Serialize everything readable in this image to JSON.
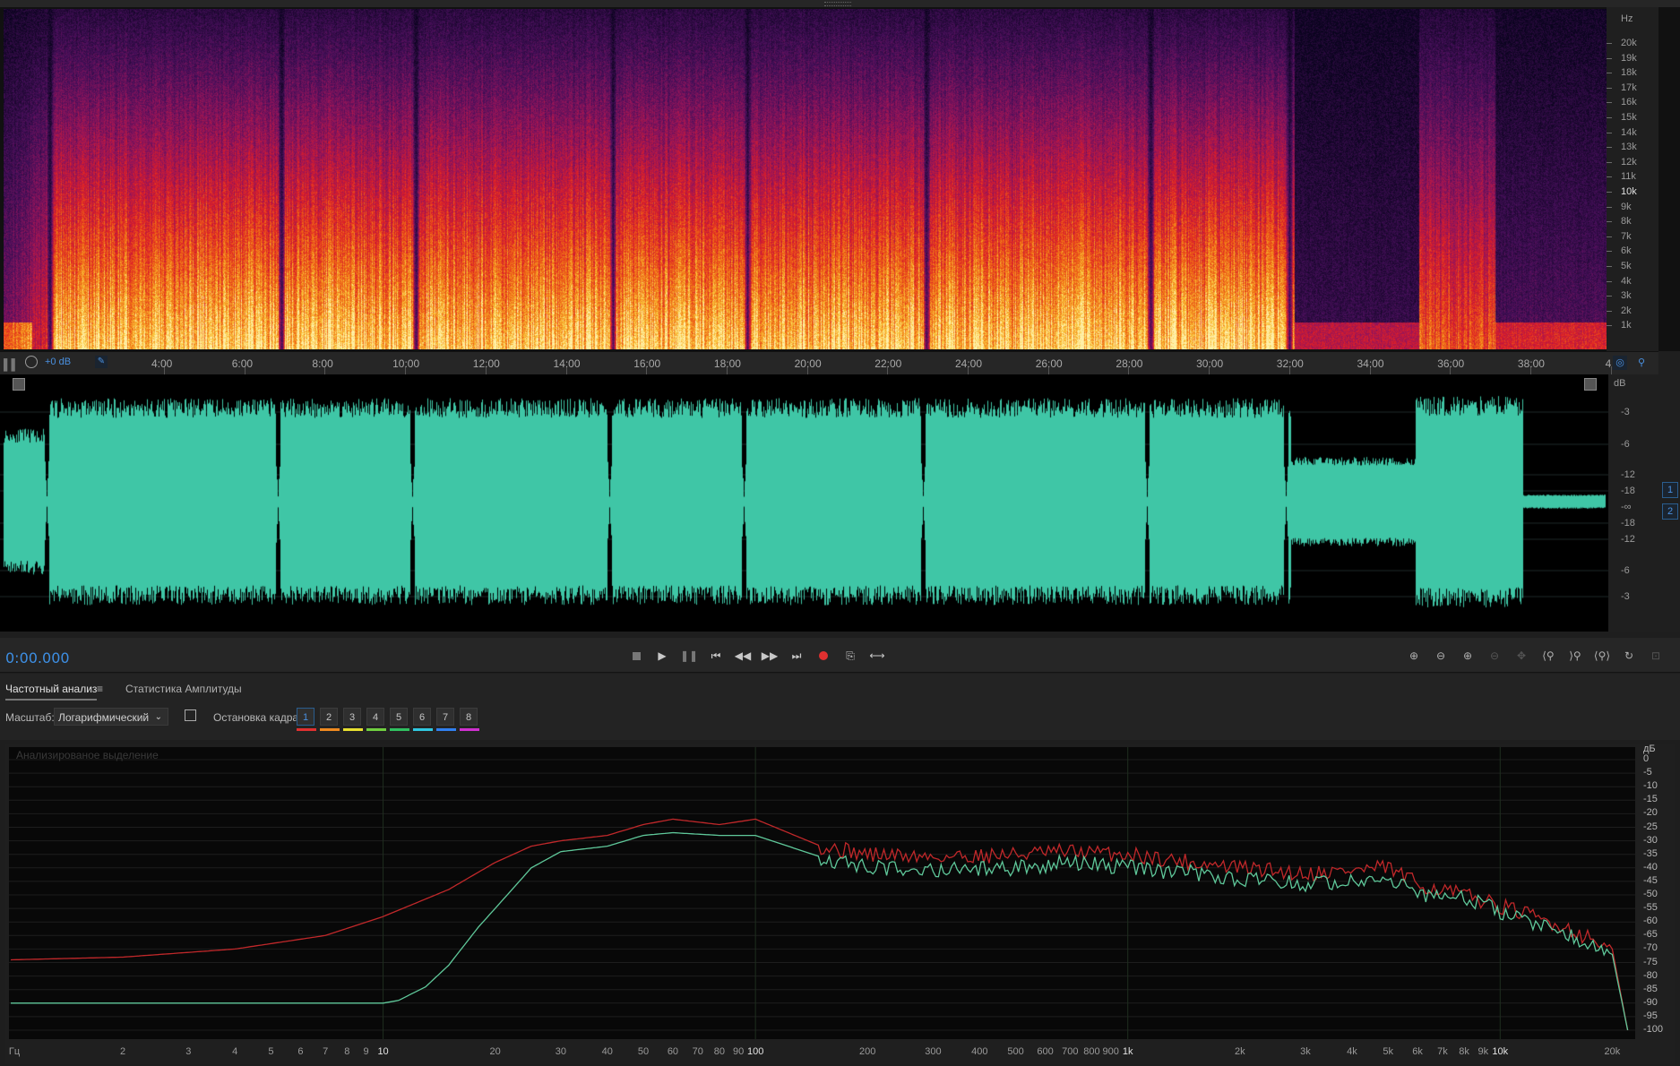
{
  "spectrogram": {
    "ruler_unit": "Hz",
    "freq_labels": [
      {
        "label": "20k",
        "hz": 20000
      },
      {
        "label": "19k",
        "hz": 19000
      },
      {
        "label": "18k",
        "hz": 18000
      },
      {
        "label": "17k",
        "hz": 17000
      },
      {
        "label": "16k",
        "hz": 16000
      },
      {
        "label": "15k",
        "hz": 15000
      },
      {
        "label": "14k",
        "hz": 14000
      },
      {
        "label": "13k",
        "hz": 13000
      },
      {
        "label": "12k",
        "hz": 12000
      },
      {
        "label": "11k",
        "hz": 11000
      },
      {
        "label": "10k",
        "hz": 10000
      },
      {
        "label": "9k",
        "hz": 9000
      },
      {
        "label": "8k",
        "hz": 8000
      },
      {
        "label": "7k",
        "hz": 7000
      },
      {
        "label": "6k",
        "hz": 6000
      },
      {
        "label": "5k",
        "hz": 5000
      },
      {
        "label": "4k",
        "hz": 4000
      },
      {
        "label": "3k",
        "hz": 3000
      },
      {
        "label": "2k",
        "hz": 2000
      },
      {
        "label": "1k",
        "hz": 1000
      }
    ]
  },
  "timeline": {
    "gain": "+0 dB",
    "labels": [
      "4:00",
      "6:00",
      "8:00",
      "10:00",
      "12:00",
      "14:00",
      "16:00",
      "18:00",
      "20:00",
      "22:00",
      "24:00",
      "26:00",
      "28:00",
      "30:00",
      "32:00",
      "34:00",
      "36:00",
      "38:00",
      "4"
    ]
  },
  "waveform": {
    "db_labels": [
      "dB",
      "-3",
      "-6",
      "-12",
      "-18",
      "-∞",
      "-18",
      "-12",
      "-6",
      "-3"
    ],
    "channels": [
      "1",
      "2"
    ],
    "wave_color": "#3fc6a6"
  },
  "transport": {
    "timecode": "0:00.000",
    "record_color": "#e03030"
  },
  "panel": {
    "tab_frequency": "Частотный анализ",
    "tab_amplitude": "Статистика Амплитуды",
    "scale_label": "Масштаб:",
    "scale_value": "Логарифмический",
    "freeze_label": "Остановка кадра:",
    "freeze_buttons": [
      "1",
      "2",
      "3",
      "4",
      "5",
      "6",
      "7",
      "8"
    ],
    "freeze_colors": [
      "#e03030",
      "#f08a20",
      "#e8e030",
      "#70d040",
      "#30c060",
      "#30c8e0",
      "#3080f0",
      "#d030d0"
    ],
    "watermark": "Анализированое выделение"
  },
  "freq_graph": {
    "db_labels": [
      "дБ",
      "0",
      "-5",
      "-10",
      "-15",
      "-20",
      "-25",
      "-30",
      "-35",
      "-40",
      "-45",
      "-50",
      "-55",
      "-60",
      "-65",
      "-70",
      "-75",
      "-80",
      "-85",
      "-90",
      "-95",
      "-100"
    ],
    "x_labels": [
      {
        "label": "Гц",
        "hz": 1
      },
      {
        "label": "2",
        "hz": 2
      },
      {
        "label": "3",
        "hz": 3
      },
      {
        "label": "4",
        "hz": 4
      },
      {
        "label": "5",
        "hz": 5
      },
      {
        "label": "6",
        "hz": 6
      },
      {
        "label": "7",
        "hz": 7
      },
      {
        "label": "8",
        "hz": 8
      },
      {
        "label": "9",
        "hz": 9
      },
      {
        "label": "10",
        "hz": 10
      },
      {
        "label": "20",
        "hz": 20
      },
      {
        "label": "30",
        "hz": 30
      },
      {
        "label": "40",
        "hz": 40
      },
      {
        "label": "50",
        "hz": 50
      },
      {
        "label": "60",
        "hz": 60
      },
      {
        "label": "70",
        "hz": 70
      },
      {
        "label": "80",
        "hz": 80
      },
      {
        "label": "90",
        "hz": 90
      },
      {
        "label": "100",
        "hz": 100
      },
      {
        "label": "200",
        "hz": 200
      },
      {
        "label": "300",
        "hz": 300
      },
      {
        "label": "400",
        "hz": 400
      },
      {
        "label": "500",
        "hz": 500
      },
      {
        "label": "600",
        "hz": 600
      },
      {
        "label": "700",
        "hz": 700
      },
      {
        "label": "800",
        "hz": 800
      },
      {
        "label": "900",
        "hz": 900
      },
      {
        "label": "1k",
        "hz": 1000
      },
      {
        "label": "2k",
        "hz": 2000
      },
      {
        "label": "3k",
        "hz": 3000
      },
      {
        "label": "4k",
        "hz": 4000
      },
      {
        "label": "5k",
        "hz": 5000
      },
      {
        "label": "6k",
        "hz": 6000
      },
      {
        "label": "7k",
        "hz": 7000
      },
      {
        "label": "8k",
        "hz": 8000
      },
      {
        "label": "9k",
        "hz": 9000
      },
      {
        "label": "10k",
        "hz": 10000
      },
      {
        "label": "20k",
        "hz": 20000
      }
    ],
    "series": [
      {
        "color": "#c0282a",
        "points": [
          [
            1,
            -74
          ],
          [
            2,
            -73
          ],
          [
            4,
            -70
          ],
          [
            7,
            -65
          ],
          [
            10,
            -58
          ],
          [
            15,
            -48
          ],
          [
            20,
            -38
          ],
          [
            25,
            -32
          ],
          [
            30,
            -30
          ],
          [
            40,
            -28
          ],
          [
            50,
            -24
          ],
          [
            60,
            -22
          ],
          [
            80,
            -24
          ],
          [
            100,
            -22
          ],
          [
            150,
            -32
          ],
          [
            200,
            -35
          ],
          [
            300,
            -36
          ],
          [
            500,
            -35
          ],
          [
            700,
            -34
          ],
          [
            1000,
            -35
          ],
          [
            1500,
            -38
          ],
          [
            2000,
            -40
          ],
          [
            3000,
            -42
          ],
          [
            5000,
            -40
          ],
          [
            6000,
            -46
          ],
          [
            8000,
            -50
          ],
          [
            10000,
            -54
          ],
          [
            15000,
            -62
          ],
          [
            20000,
            -70
          ],
          [
            22000,
            -100
          ]
        ]
      },
      {
        "color": "#5fc89a",
        "points": [
          [
            1,
            -90
          ],
          [
            10,
            -90
          ],
          [
            11,
            -89
          ],
          [
            13,
            -84
          ],
          [
            15,
            -76
          ],
          [
            18,
            -62
          ],
          [
            20,
            -55
          ],
          [
            25,
            -40
          ],
          [
            30,
            -34
          ],
          [
            40,
            -32
          ],
          [
            50,
            -28
          ],
          [
            60,
            -27
          ],
          [
            80,
            -28
          ],
          [
            100,
            -28
          ],
          [
            150,
            -36
          ],
          [
            200,
            -40
          ],
          [
            300,
            -41
          ],
          [
            500,
            -40
          ],
          [
            700,
            -38
          ],
          [
            1000,
            -40
          ],
          [
            1500,
            -42
          ],
          [
            2000,
            -44
          ],
          [
            3000,
            -46
          ],
          [
            5000,
            -43
          ],
          [
            6000,
            -50
          ],
          [
            8000,
            -51
          ],
          [
            10000,
            -56
          ],
          [
            15000,
            -64
          ],
          [
            20000,
            -72
          ],
          [
            22000,
            -100
          ]
        ]
      }
    ]
  }
}
